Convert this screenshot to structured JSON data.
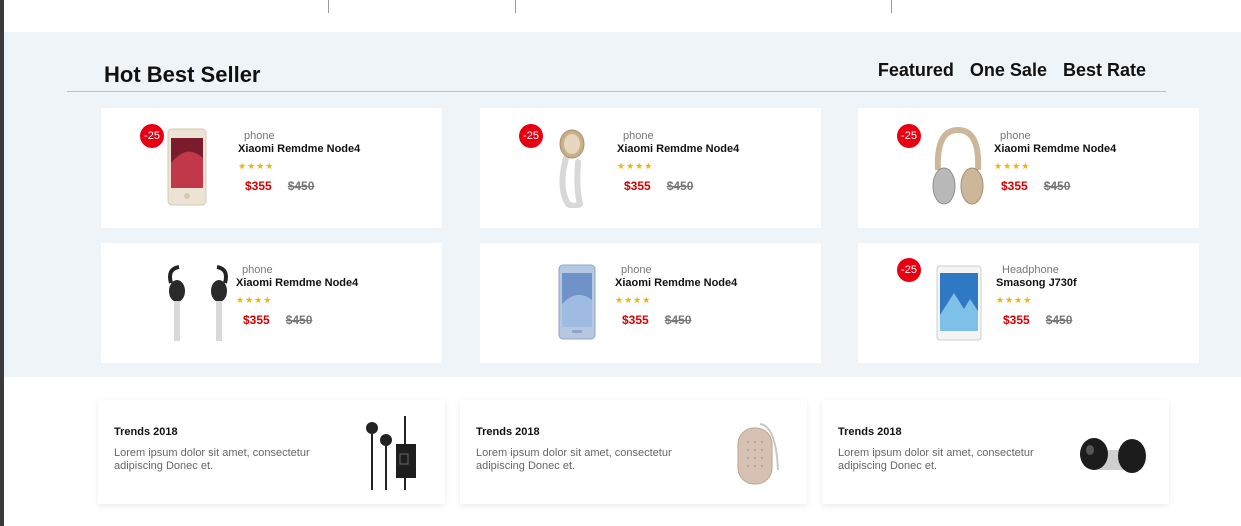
{
  "section": {
    "title": "Hot Best Seller",
    "tabs": [
      "Featured",
      "One Sale",
      "Best Rate"
    ]
  },
  "products": [
    {
      "badge": "-25",
      "category": "phone",
      "name": "Xiaomi Remdme Node4",
      "stars": "★★★★",
      "price": "$355",
      "old_price": "$450",
      "icon": "smartphone-gold"
    },
    {
      "badge": "-25",
      "category": "phone",
      "name": "Xiaomi Remdme Node4",
      "stars": "★★★★",
      "price": "$355",
      "old_price": "$450",
      "icon": "fitness-band"
    },
    {
      "badge": "-25",
      "category": "phone",
      "name": "Xiaomi Remdme Node4",
      "stars": "★★★★",
      "price": "$355",
      "old_price": "$450",
      "icon": "headphones"
    },
    {
      "badge": "",
      "category": "phone",
      "name": "Xiaomi Remdme Node4",
      "stars": "★★★★",
      "price": "$355",
      "old_price": "$450",
      "icon": "earphones"
    },
    {
      "badge": "",
      "category": "phone",
      "name": "Xiaomi Remdme Node4",
      "stars": "★★★★",
      "price": "$355",
      "old_price": "$450",
      "icon": "smartphone-blue"
    },
    {
      "badge": "-25",
      "category": "Headphone",
      "name": "Smasong J730f",
      "stars": "★★★★",
      "price": "$355",
      "old_price": "$450",
      "icon": "tablet"
    }
  ],
  "trends": [
    {
      "title": "Trends 2018",
      "text": "Lorem ipsum dolor sit amet, consectetur adipiscing Donec et.",
      "icon": "earphones-remote"
    },
    {
      "title": "Trends 2018",
      "text": "Lorem ipsum dolor sit amet, consectetur adipiscing Donec et.",
      "icon": "portable-speaker"
    },
    {
      "title": "Trends 2018",
      "text": "Lorem ipsum dolor sit amet, consectetur adipiscing Donec et.",
      "icon": "speaker-dock"
    }
  ],
  "colors": {
    "accent": "#e60012",
    "stars": "#f5b200",
    "section_bg": "#eef4f8"
  }
}
